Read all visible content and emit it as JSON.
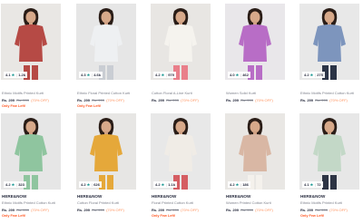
{
  "products": [
    {
      "brand": "",
      "name": "Ethnic Motifs Printed Kurti",
      "rating": "4.1",
      "count": "1.2k",
      "price": "Rs. 299",
      "mrp": "Rs. 999",
      "discount": "(70% OFF)",
      "stock": "Only Few Left!",
      "top_color": "#b64a45",
      "bottom_color": "#b64a45",
      "bg_color": "#e9e7e4"
    },
    {
      "brand": "",
      "name": "Ethnic Floral Printed Cotton Kurti",
      "rating": "4.3",
      "count": "4.6k",
      "price": "Rs. 299",
      "mrp": "Rs. 999",
      "discount": "(70% OFF)",
      "stock": "Only Few Left!",
      "top_color": "#eef0f2",
      "bottom_color": "#c9cdd3",
      "bg_color": "#e6e6e6"
    },
    {
      "brand": "",
      "name": "Cotton Floral A-Line Kurti",
      "rating": "4.2",
      "count": "979",
      "price": "Rs. 299",
      "mrp": "Rs. 999",
      "discount": "(70% OFF)",
      "stock": "",
      "top_color": "#f5f3ee",
      "bottom_color": "#e97f8a",
      "bg_color": "#e8e6e3"
    },
    {
      "brand": "",
      "name": "Women Solid Kurti",
      "rating": "4.0",
      "count": "462",
      "price": "Rs. 299",
      "mrp": "Rs. 999",
      "discount": "(70% OFF)",
      "stock": "",
      "top_color": "#b86dc6",
      "bottom_color": "#b86dc6",
      "bg_color": "#e9e7ea"
    },
    {
      "brand": "",
      "name": "Ethnic Motifs Printed Cotton Kurti",
      "rating": "4.2",
      "count": "275",
      "price": "Rs. 299",
      "mrp": "Rs. 999",
      "discount": "(70% OFF)",
      "stock": "",
      "top_color": "#7d95bd",
      "bottom_color": "#2b3446",
      "bg_color": "#e8e8e8"
    },
    {
      "brand": "HERE&NOW",
      "name": "Ethnic Motifs Printed Cotton Kurti",
      "rating": "4.2",
      "count": "323",
      "price": "Rs. 299",
      "mrp": "Rs. 999",
      "discount": "(70% OFF)",
      "stock": "Only Few Left!",
      "top_color": "#8fc59f",
      "bottom_color": "#8fc59f",
      "bg_color": "#e6e6e6"
    },
    {
      "brand": "HERE&NOW",
      "name": "Cotton Floral Printed Kurti",
      "rating": "4.2",
      "count": "626",
      "price": "Rs. 299",
      "mrp": "Rs. 999",
      "discount": "(70% OFF)",
      "stock": "",
      "top_color": "#e5a83a",
      "bottom_color": "#e5a83a",
      "bg_color": "#e7e6e4"
    },
    {
      "brand": "HERE&NOW",
      "name": "Floral Printed Cotton Kurti",
      "rating": "4.2",
      "count": "1.1k",
      "price": "Rs. 299",
      "mrp": "Rs. 999",
      "discount": "(70% OFF)",
      "stock": "Only Few Left!",
      "top_color": "#f0ece6",
      "bottom_color": "#d55e63",
      "bg_color": "#e8e8e8"
    },
    {
      "brand": "HERE&NOW",
      "name": "Women Printed Cotton Kurti",
      "rating": "4.2",
      "count": "186",
      "price": "Rs. 299",
      "mrp": "Rs. 999",
      "discount": "(70% OFF)",
      "stock": "",
      "top_color": "#d9b7a4",
      "bottom_color": "#f4f1ec",
      "bg_color": "#e9e7e4"
    },
    {
      "brand": "HERE&NOW",
      "name": "Ethnic Motifs Printed Kurti",
      "rating": "4.1",
      "count": "72",
      "price": "Rs. 299",
      "mrp": "Rs. 999",
      "discount": "(70% OFF)",
      "stock": "Only Few Left!",
      "top_color": "#c3d8c7",
      "bottom_color": "#2d3444",
      "bg_color": "#e7e7e7"
    }
  ]
}
